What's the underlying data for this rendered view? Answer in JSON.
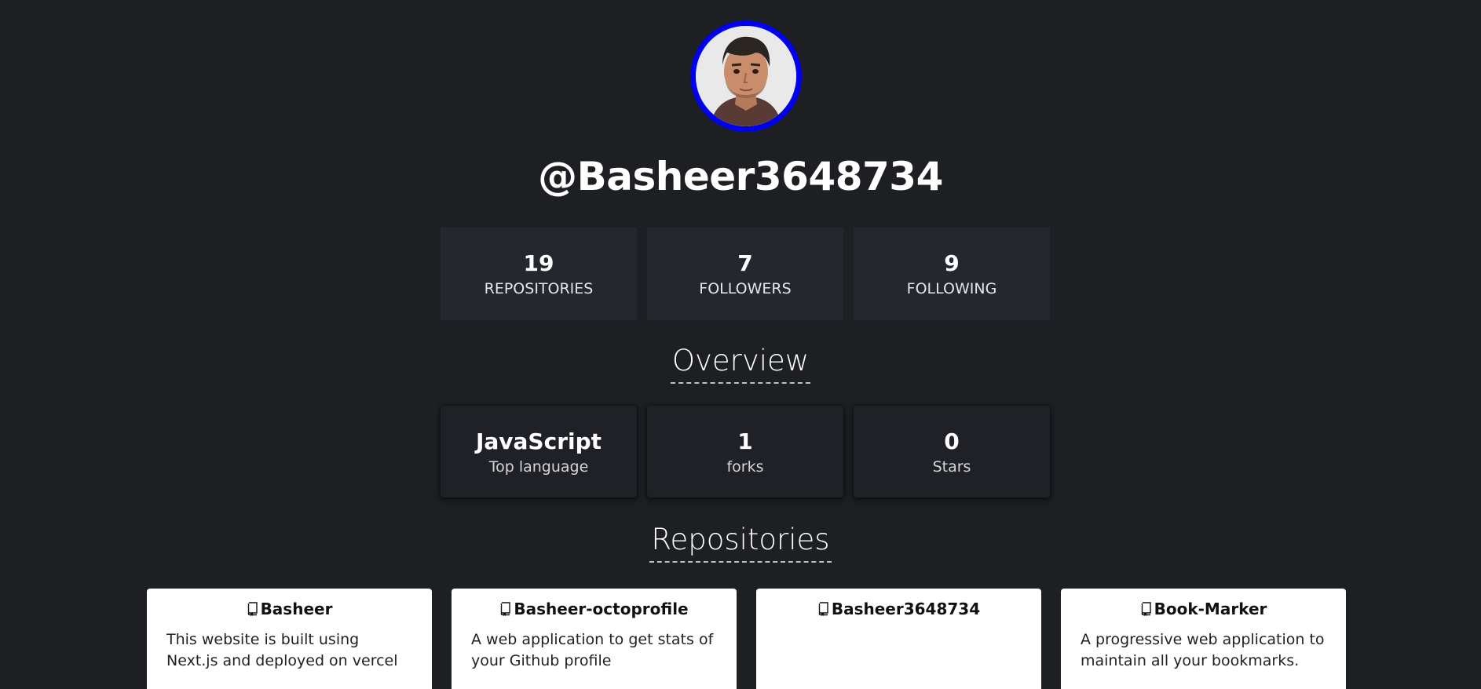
{
  "profile": {
    "username": "@Basheer3648734",
    "avatar_alt": "avatar"
  },
  "stats": [
    {
      "value": "19",
      "label": "REPOSITORIES"
    },
    {
      "value": "7",
      "label": "FOLLOWERS"
    },
    {
      "value": "9",
      "label": "FOLLOWING"
    }
  ],
  "overview": {
    "title": "Overview",
    "cards": [
      {
        "value": "JavaScript",
        "label": "Top language"
      },
      {
        "value": "1",
        "label": "forks"
      },
      {
        "value": "0",
        "label": "Stars"
      }
    ]
  },
  "repositories": {
    "title": "Repositories",
    "items": [
      {
        "name": "Basheer",
        "description": "This website is built using Next.js and deployed on vercel",
        "icon": "book-icon"
      },
      {
        "name": "Basheer-octoprofile",
        "description": "A web application to get stats of your Github profile",
        "icon": "book-icon"
      },
      {
        "name": "Basheer3648734",
        "description": "",
        "icon": "book-icon"
      },
      {
        "name": "Book-Marker",
        "description": "A progressive web application to maintain all your bookmarks.",
        "icon": "book-icon"
      }
    ]
  },
  "colors": {
    "background": "#1d1f23",
    "card": "#24282e",
    "avatar_ring": "#0000ee"
  }
}
